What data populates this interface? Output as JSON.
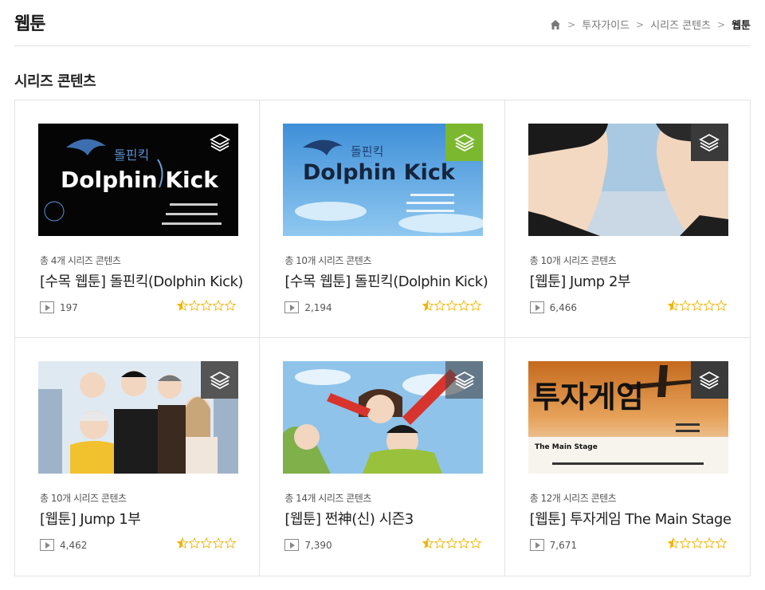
{
  "header": {
    "title": "웹툰",
    "breadcrumb": [
      "투자가이드",
      "시리즈 콘텐츠",
      "웹툰"
    ]
  },
  "section_title": "시리즈 콘텐츠",
  "colors": {
    "star": "#f0b400",
    "badge_green": "#7cb82f",
    "badge_gray": "#555555"
  },
  "cards": [
    {
      "count": "총 4개 시리즈 콘텐츠",
      "title": "[수목 웹툰] 돌핀킥(Dolphin Kick)",
      "views": "197",
      "rating": 0.5,
      "thumb_text": "Dolphin Kick",
      "thumb_sub": "돌핀킥",
      "badge": "gray"
    },
    {
      "count": "총 10개 시리즈 콘텐츠",
      "title": "[수목 웹툰] 돌핀킥(Dolphin Kick)",
      "views": "2,194",
      "rating": 0.5,
      "thumb_text": "Dolphin Kick",
      "thumb_sub": "돌핀킥",
      "badge": "green"
    },
    {
      "count": "총 10개 시리즈 콘텐츠",
      "title": "[웹툰] Jump 2부",
      "views": "6,466",
      "rating": 0.5,
      "badge": "gray"
    },
    {
      "count": "총 10개 시리즈 콘텐츠",
      "title": "[웹툰] Jump 1부",
      "views": "4,462",
      "rating": 0.5,
      "badge": "gray"
    },
    {
      "count": "총 14개 시리즈 콘텐츠",
      "title": "[웹툰] 쩐神(신) 시즌3",
      "views": "7,390",
      "rating": 0.5,
      "badge": "gray"
    },
    {
      "count": "총 12개 시리즈 콘텐츠",
      "title": "[웹툰] 투자게임 The Main Stage",
      "views": "7,671",
      "rating": 0.5,
      "thumb_text": "투자게임",
      "thumb_sub": "The Main Stage",
      "badge": "gray"
    }
  ]
}
